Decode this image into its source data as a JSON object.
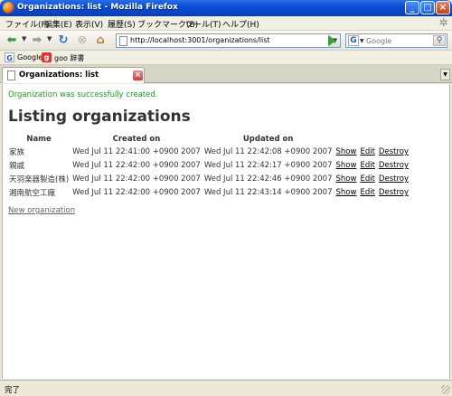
{
  "window": {
    "title": "Organizations: list - Mozilla Firefox"
  },
  "menubar": {
    "items": [
      "ファイル(F)",
      "編集(E)",
      "表示(V)",
      "履歴(S)",
      "ブックマーク(B)",
      "ツール(T)",
      "ヘルプ(H)"
    ]
  },
  "navigation": {
    "url": "http://localhost:3001/organizations/list",
    "search_placeholder": "Google",
    "search_engine": "G"
  },
  "bookmarks": {
    "items": [
      {
        "label": "Google",
        "icon": "google-icon"
      },
      {
        "label": "goo 辞書",
        "icon": "goo-icon"
      }
    ]
  },
  "tabs": [
    {
      "label": "Organizations: list",
      "active": true
    }
  ],
  "page": {
    "notice": "Organization was successfully created.",
    "heading": "Listing organizations",
    "columns": [
      "Name",
      "Created on",
      "Updated on"
    ],
    "rows": [
      {
        "name": "家族",
        "created_on": "Wed Jul 11 22:41:00 +0900 2007",
        "updated_on": "Wed Jul 11 22:42:08 +0900 2007"
      },
      {
        "name": "親戚",
        "created_on": "Wed Jul 11 22:42:00 +0900 2007",
        "updated_on": "Wed Jul 11 22:42:17 +0900 2007"
      },
      {
        "name": "天羽楽器製造(株)",
        "created_on": "Wed Jul 11 22:42:00 +0900 2007",
        "updated_on": "Wed Jul 11 22:42:46 +0900 2007"
      },
      {
        "name": "湘南航空工廠",
        "created_on": "Wed Jul 11 22:42:00 +0900 2007",
        "updated_on": "Wed Jul 11 22:43:14 +0900 2007"
      }
    ],
    "actions": {
      "show": "Show",
      "edit": "Edit",
      "destroy": "Destroy"
    },
    "new_link": "New organization"
  },
  "status": {
    "text": "完了"
  },
  "colors": {
    "notice": "#2f8f2f",
    "titlebar": "#0A4ED4"
  }
}
